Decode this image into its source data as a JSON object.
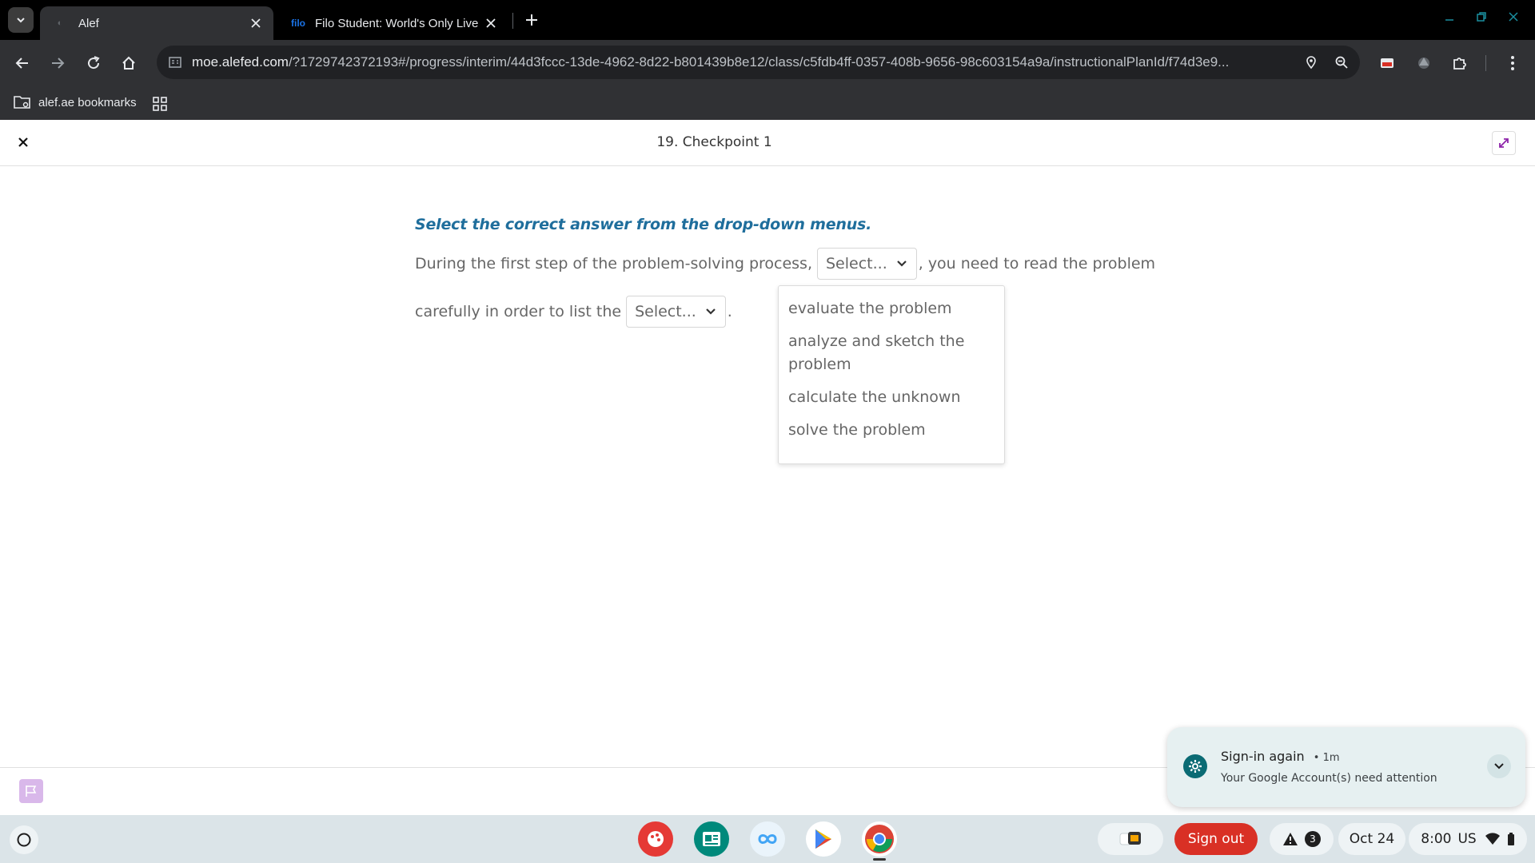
{
  "browser": {
    "tabs": [
      {
        "title": "Alef",
        "favicon": "alef-favicon",
        "active": true
      },
      {
        "title": "Filo Student: World's Only Live I",
        "favicon": "filo",
        "active": false
      }
    ],
    "url_host": "moe.alefed.com",
    "url_path": "/?1729742372193#/progress/interim/44d3fccc-13de-4962-8d22-b801439b8e12/class/c5fdb4ff-0357-408b-9656-98c603154a9a/instructionalPlanId/f74d3e9...",
    "bookmark_label": "alef.ae bookmarks"
  },
  "page": {
    "title": "19. Checkpoint 1",
    "instruction": "Select the correct answer from the drop-down menus.",
    "sentence": {
      "part1": "During the first step of the problem-solving process,",
      "part2": ", you need to read the problem",
      "part3": "carefully in order to list the",
      "part4": "."
    },
    "select1_label": "Select...",
    "select2_label": "Select...",
    "dropdown_options": [
      "evaluate the problem",
      "analyze and sketch the problem",
      "calculate the unknown",
      "solve the problem"
    ]
  },
  "notification": {
    "title": "Sign-in again",
    "time": "• 1m",
    "body": "Your Google Account(s) need attention"
  },
  "shelf": {
    "sign_out": "Sign out",
    "alerts_count": "3",
    "date": "Oct 24",
    "time": "8:00",
    "locale": "US"
  },
  "colors": {
    "instruction": "#1f6e9c",
    "signout": "#d93025",
    "notif_icon": "#0b6b74"
  }
}
